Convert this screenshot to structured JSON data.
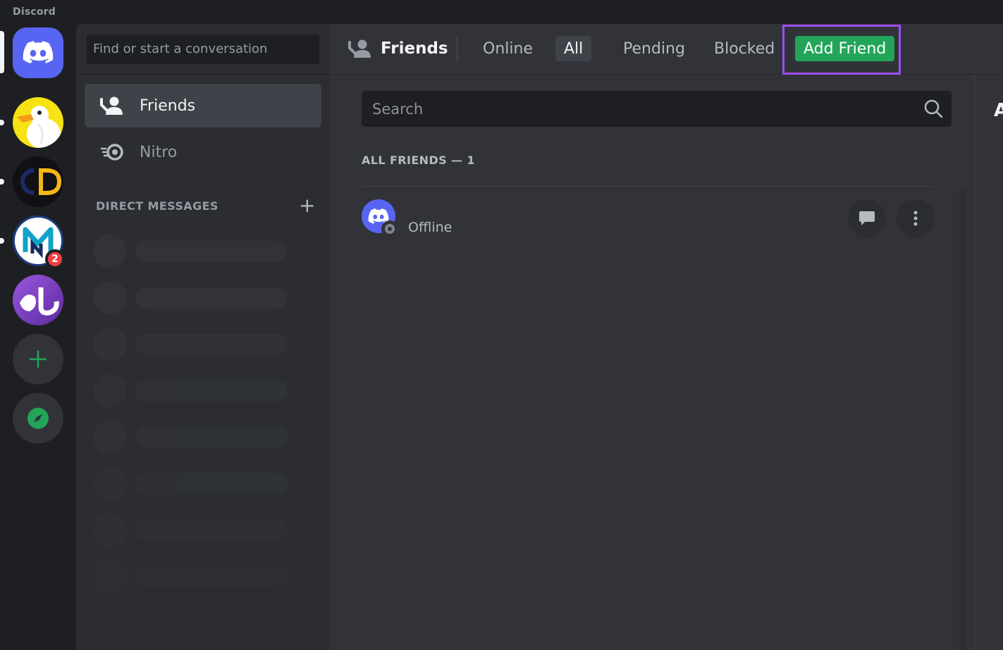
{
  "app": {
    "wordmark": "Discord"
  },
  "servers": [
    {
      "name": "Home",
      "icon": "discord-logo"
    },
    {
      "name": "Goose server",
      "icon": "goose-avatar"
    },
    {
      "name": "CD server",
      "icon": "cd-logo"
    },
    {
      "name": "MN server",
      "icon": "mn-logo",
      "badge": "2"
    },
    {
      "name": "Purple server",
      "icon": "purple-logo"
    },
    {
      "name": "Add a Server",
      "icon": "plus-icon"
    },
    {
      "name": "Explore",
      "icon": "compass-icon"
    }
  ],
  "sidebar": {
    "search_placeholder": "Find or start a conversation",
    "items": [
      {
        "label": "Friends",
        "icon": "friends-icon",
        "active": true
      },
      {
        "label": "Nitro",
        "icon": "nitro-icon",
        "active": false
      }
    ],
    "dm_header": "DIRECT MESSAGES",
    "dm_add": "+"
  },
  "header": {
    "title": "Friends",
    "tabs": [
      {
        "label": "Online"
      },
      {
        "label": "All",
        "selected": true
      },
      {
        "label": "Pending"
      },
      {
        "label": "Blocked"
      },
      {
        "label": "Add Friend",
        "primary": true
      }
    ]
  },
  "main": {
    "search_placeholder": "Search",
    "count_label": "ALL FRIENDS — 1",
    "friends": [
      {
        "status": "Offline"
      }
    ],
    "right_letter": "A"
  },
  "colors": {
    "brand": "#5865f2",
    "green": "#23a559",
    "highlight": "#9f4df5",
    "badge": "#f23f43"
  }
}
